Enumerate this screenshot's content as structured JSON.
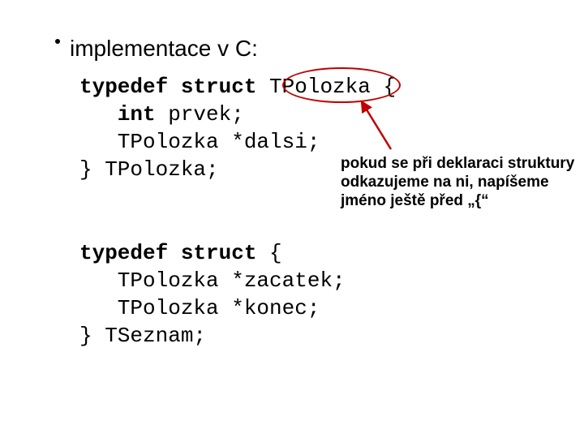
{
  "heading": "implementace v C:",
  "code1": {
    "l1_kw": "typedef struct",
    "l1_rest": " TPolozka {",
    "l2_kw": "   int",
    "l2_rest": " prvek;",
    "l3": "   TPolozka *dalsi;",
    "l4": "} TPolozka;"
  },
  "code2": {
    "l1_kw": "typedef struct",
    "l1_rest": " {",
    "l2": "   TPolozka *zacatek;",
    "l3": "   TPolozka *konec;",
    "l4": "} TSeznam;"
  },
  "note": "pokud se při deklaraci struktury odkazujeme na ni, napíšeme jméno ještě před „{“"
}
